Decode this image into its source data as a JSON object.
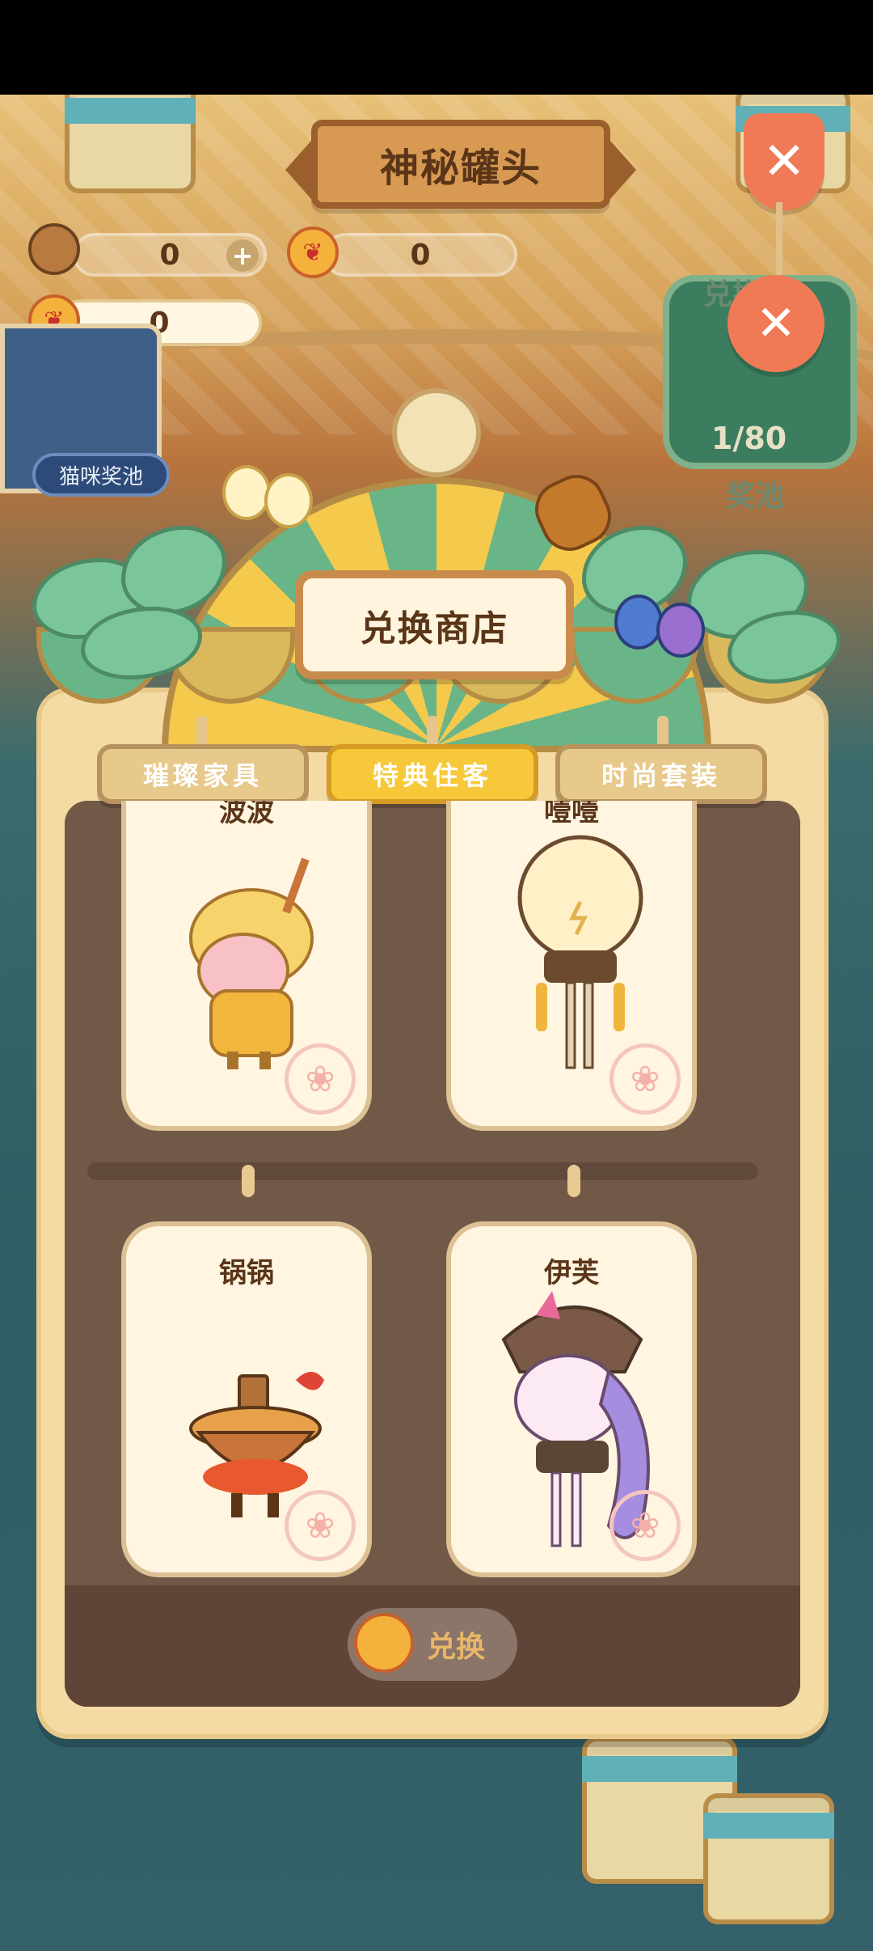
{
  "header": {
    "title": "神秘罐头",
    "close_icon": "close-x-icon"
  },
  "currencies": {
    "fish_bone": {
      "value": "0",
      "icon": "fish-bone-bag-icon"
    },
    "bell_red": {
      "value": "0",
      "icon": "bell-gift-icon"
    },
    "bell_gold": {
      "value": "0",
      "icon": "bell-gift-icon"
    }
  },
  "side": {
    "cat_pool_label": "猫咪奖池",
    "exchange_house_label": "兑换屋",
    "pool_count": "1/80",
    "pool_label": "奖池"
  },
  "shop": {
    "sign": "兑换商店",
    "tabs": [
      {
        "label": "璀璨家具",
        "active": false
      },
      {
        "label": "特典住客",
        "active": true
      },
      {
        "label": "时尚套装",
        "active": false
      }
    ],
    "cards": [
      {
        "name": "波波",
        "character": "bubble-tea-girl"
      },
      {
        "name": "噎噎",
        "character": "lightbulb-creature"
      },
      {
        "name": "锅锅",
        "character": "hotpot-creature"
      },
      {
        "name": "伊芙",
        "character": "unicorn-witch"
      }
    ],
    "exchange_button": {
      "label": "兑换",
      "icon": "bell-gift-icon"
    }
  },
  "colors": {
    "tab_active": "#f7c93a",
    "tab_inactive": "#e8c98c",
    "panel_bg": "#725847",
    "card_bg": "#fff5e1",
    "close_tag": "#f07a55"
  }
}
